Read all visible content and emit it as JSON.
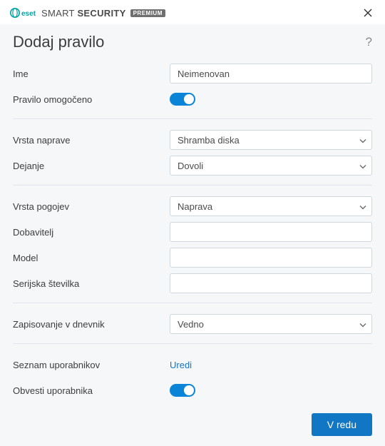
{
  "titlebar": {
    "brand_prefix": "SMART",
    "brand_suffix": "SECURITY",
    "premium": "PREMIUM"
  },
  "header": {
    "title": "Dodaj pravilo"
  },
  "labels": {
    "name": "Ime",
    "enabled": "Pravilo omogočeno",
    "device_type": "Vrsta naprave",
    "action": "Dejanje",
    "criteria_type": "Vrsta pogojev",
    "vendor": "Dobavitelj",
    "model": "Model",
    "serial": "Serijska številka",
    "logging": "Zapisovanje v dnevnik",
    "user_list": "Seznam uporabnikov",
    "notify": "Obvesti uporabnika"
  },
  "values": {
    "name": "Neimenovan",
    "device_type": "Shramba diska",
    "action": "Dovoli",
    "criteria_type": "Naprava",
    "vendor": "",
    "model": "",
    "serial": "",
    "logging": "Vedno",
    "enabled": true,
    "notify": true
  },
  "links": {
    "edit": "Uredi"
  },
  "buttons": {
    "ok": "V redu"
  }
}
